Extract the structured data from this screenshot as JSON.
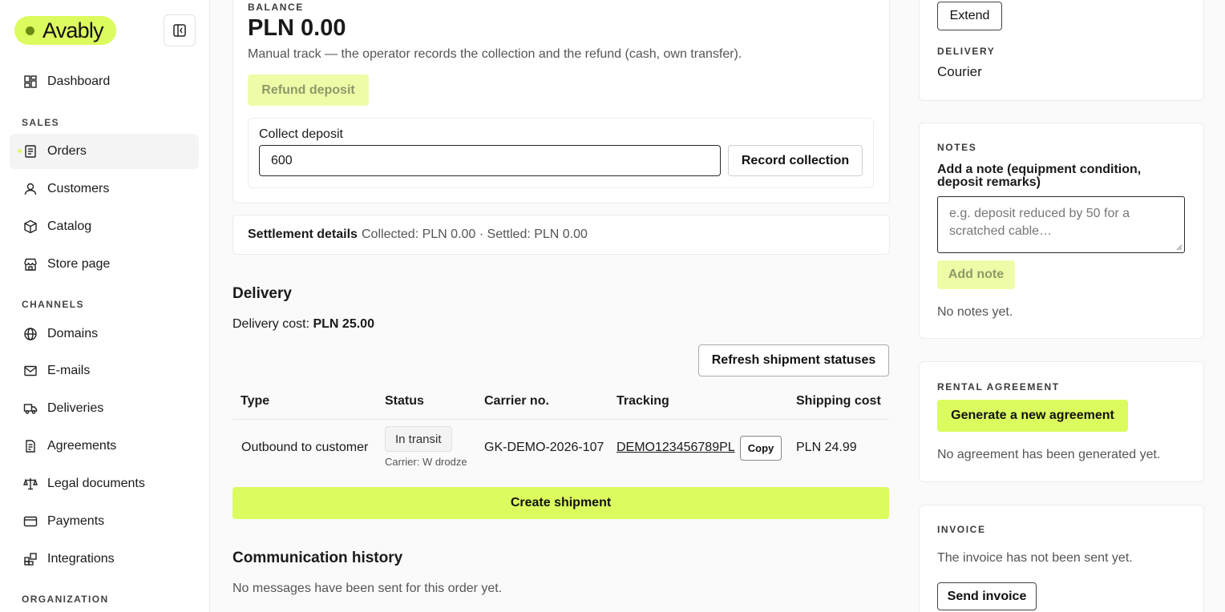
{
  "brand": {
    "name": "Avably"
  },
  "sidebar": {
    "items": [
      {
        "label": "Dashboard",
        "icon": "dashboard-icon"
      },
      {
        "label": "Orders",
        "icon": "orders-icon"
      },
      {
        "label": "Customers",
        "icon": "user-icon"
      },
      {
        "label": "Catalog",
        "icon": "box-icon"
      },
      {
        "label": "Store page",
        "icon": "store-icon"
      },
      {
        "label": "Domains",
        "icon": "globe-icon"
      },
      {
        "label": "E-mails",
        "icon": "mail-icon"
      },
      {
        "label": "Deliveries",
        "icon": "truck-icon"
      },
      {
        "label": "Agreements",
        "icon": "document-icon"
      },
      {
        "label": "Legal documents",
        "icon": "scale-icon"
      },
      {
        "label": "Payments",
        "icon": "card-icon"
      },
      {
        "label": "Integrations",
        "icon": "integrations-icon"
      }
    ],
    "sections": {
      "sales": "SALES",
      "channels": "CHANNELS",
      "organization": "ORGANIZATION"
    },
    "active": "Orders"
  },
  "deposit": {
    "balance_label": "BALANCE",
    "balance_value": "PLN 0.00",
    "manual_note": "Manual track — the operator records the collection and the refund (cash, own transfer).",
    "refund_button": "Refund deposit",
    "collect_label": "Collect deposit",
    "collect_value": "600",
    "record_button": "Record collection"
  },
  "settlement": {
    "title": "Settlement details",
    "summary": "Collected: PLN 0.00 · Settled: PLN 0.00"
  },
  "delivery": {
    "title": "Delivery",
    "cost_label": "Delivery cost:",
    "cost_value": "PLN 25.00",
    "refresh_button": "Refresh shipment statuses",
    "columns": [
      "Type",
      "Status",
      "Carrier no.",
      "Tracking",
      "Shipping cost"
    ],
    "row": {
      "type": "Outbound to customer",
      "status": "In transit",
      "carrier_note": "Carrier: W drodze",
      "carrier_no": "GK-DEMO-2026-107",
      "tracking": "DEMO123456789PL",
      "copy_button": "Copy",
      "shipping_cost": "PLN 24.99"
    },
    "create_button": "Create shipment"
  },
  "communication": {
    "title": "Communication history",
    "empty": "No messages have been sent for this order yet."
  },
  "right": {
    "extend_button": "Extend",
    "delivery_label": "DELIVERY",
    "delivery_value": "Courier",
    "notes_label": "NOTES",
    "notes_prompt": "Add a note (equipment condition, deposit remarks)",
    "notes_placeholder": "e.g. deposit reduced by 50 for a scratched cable…",
    "add_note_button": "Add note",
    "notes_empty": "No notes yet.",
    "agreement_label": "RENTAL AGREEMENT",
    "agreement_button": "Generate a new agreement",
    "agreement_empty": "No agreement has been generated yet.",
    "invoice_label": "INVOICE",
    "invoice_empty": "The invoice has not been sent yet.",
    "invoice_button": "Send invoice"
  },
  "colors": {
    "accent": "#dcfb5e",
    "accent_dim": "#eefca8",
    "border": "#ececec"
  }
}
